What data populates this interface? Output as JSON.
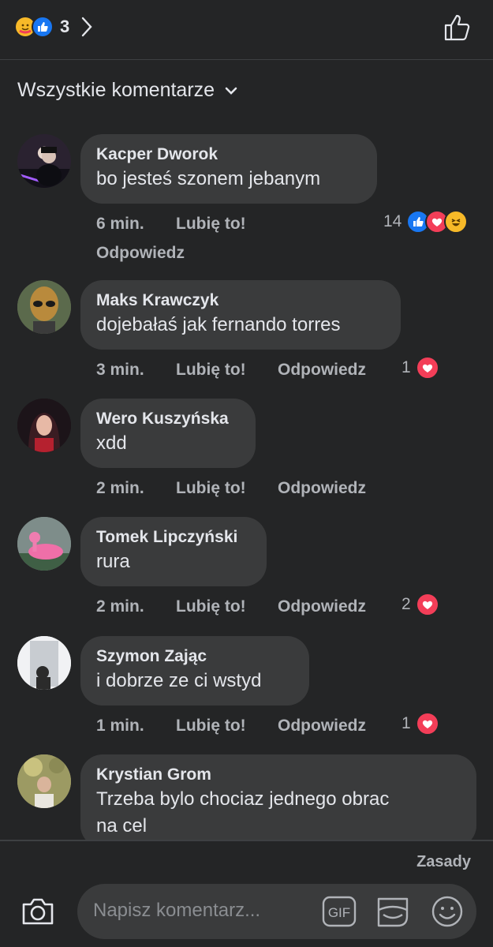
{
  "header": {
    "reaction_icons": [
      "care-reaction-icon",
      "like-reaction-icon"
    ],
    "reaction_count": "3"
  },
  "filter": {
    "label": "Wszystkie komentarze"
  },
  "comments": [
    {
      "author": "Kacper Dworok",
      "text": "bo jesteś szonem jebanym",
      "time": "6 min.",
      "like": "Lubię to!",
      "reply": "Odpowiedz",
      "reaction_count": "14",
      "reactions": [
        "like",
        "love",
        "haha"
      ]
    },
    {
      "author": "Maks Krawczyk",
      "text": "dojebałaś jak fernando torres",
      "time": "3 min.",
      "like": "Lubię to!",
      "reply": "Odpowiedz",
      "reaction_count": "1",
      "reactions": [
        "love"
      ]
    },
    {
      "author": "Wero Kuszyńska",
      "text": "xdd",
      "time": "2 min.",
      "like": "Lubię to!",
      "reply": "Odpowiedz",
      "reaction_count": "",
      "reactions": []
    },
    {
      "author": "Tomek Lipczyński",
      "text": "rura",
      "time": "2 min.",
      "like": "Lubię to!",
      "reply": "Odpowiedz",
      "reaction_count": "2",
      "reactions": [
        "love"
      ]
    },
    {
      "author": "Szymon Zając",
      "text": "i dobrze ze ci wstyd",
      "time": "1 min.",
      "like": "Lubię to!",
      "reply": "Odpowiedz",
      "reaction_count": "1",
      "reactions": [
        "love"
      ]
    },
    {
      "author": "Krystian Grom",
      "text": "Trzeba bylo chociaz jednego obrac\nna cel",
      "time": "",
      "like": "",
      "reply": "",
      "reaction_count": "",
      "reactions": []
    }
  ],
  "footer": {
    "rules_label": "Zasady",
    "composer_placeholder": "Napisz komentarz...",
    "gif_label": "GIF"
  },
  "colors": {
    "background": "#242526",
    "bubble": "#3a3b3c",
    "like_blue": "#1877f2",
    "love_red": "#f33e58",
    "haha_yellow": "#f7b928",
    "secondary_text": "#b0b3b8"
  }
}
